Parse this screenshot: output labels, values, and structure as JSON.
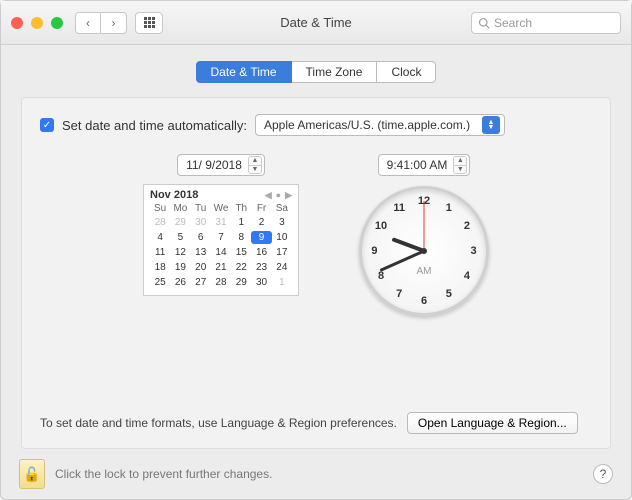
{
  "window": {
    "title": "Date & Time"
  },
  "search": {
    "placeholder": "Search"
  },
  "tabs": {
    "date_time": "Date & Time",
    "time_zone": "Time Zone",
    "clock": "Clock"
  },
  "auto": {
    "label": "Set date and time automatically:",
    "server": "Apple Americas/U.S. (time.apple.com.)"
  },
  "date": {
    "value": "11/ 9/2018"
  },
  "time": {
    "value": "9:41:00 AM"
  },
  "calendar": {
    "month_label": "Nov 2018",
    "dow": [
      "Su",
      "Mo",
      "Tu",
      "We",
      "Th",
      "Fr",
      "Sa"
    ],
    "days": [
      {
        "n": "28",
        "out": true
      },
      {
        "n": "29",
        "out": true
      },
      {
        "n": "30",
        "out": true
      },
      {
        "n": "31",
        "out": true
      },
      {
        "n": "1"
      },
      {
        "n": "2"
      },
      {
        "n": "3"
      },
      {
        "n": "4"
      },
      {
        "n": "5"
      },
      {
        "n": "6"
      },
      {
        "n": "7"
      },
      {
        "n": "8"
      },
      {
        "n": "9",
        "sel": true
      },
      {
        "n": "10"
      },
      {
        "n": "11"
      },
      {
        "n": "12"
      },
      {
        "n": "13"
      },
      {
        "n": "14"
      },
      {
        "n": "15"
      },
      {
        "n": "16"
      },
      {
        "n": "17"
      },
      {
        "n": "18"
      },
      {
        "n": "19"
      },
      {
        "n": "20"
      },
      {
        "n": "21"
      },
      {
        "n": "22"
      },
      {
        "n": "23"
      },
      {
        "n": "24"
      },
      {
        "n": "25"
      },
      {
        "n": "26"
      },
      {
        "n": "27"
      },
      {
        "n": "28"
      },
      {
        "n": "29"
      },
      {
        "n": "30"
      },
      {
        "n": "1",
        "out": true
      }
    ]
  },
  "clock": {
    "ampm": "AM",
    "numbers": [
      "12",
      "1",
      "2",
      "3",
      "4",
      "5",
      "6",
      "7",
      "8",
      "9",
      "10",
      "11"
    ],
    "hour_angle": 290.5,
    "minute_angle": 246,
    "second_angle": 0
  },
  "footer": {
    "hint": "To set date and time formats, use Language & Region preferences.",
    "button": "Open Language & Region..."
  },
  "lock": {
    "text": "Click the lock to prevent further changes."
  },
  "help": {
    "label": "?"
  }
}
